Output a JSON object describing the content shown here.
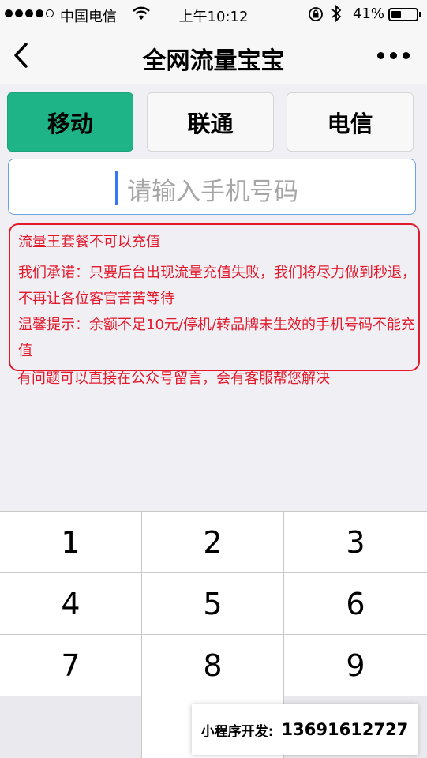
{
  "status_bar": {
    "carrier": "中国电信",
    "time": "上午10:12",
    "battery_percent": "41%",
    "battery_level": 0.41,
    "signal_bars_filled": 4,
    "signal_bars_total": 5
  },
  "nav": {
    "title": "全网流量宝宝"
  },
  "tabs": [
    {
      "label": "移动",
      "active": true
    },
    {
      "label": "联通",
      "active": false
    },
    {
      "label": "电信",
      "active": false
    }
  ],
  "phone_input": {
    "placeholder": "请输入手机号码",
    "value": ""
  },
  "notice": {
    "line1": "流量王套餐不可以充值",
    "line2": "我们承诺：只要后台出现流量充值失败，我们将尽力做到秒退，不再让各位客官苦苦等待",
    "line3": "温馨提示：余额不足10元/停机/转品牌未生效的手机号码不能充值",
    "help": "有问题可以直接在公众号留言，会有客服帮您解决"
  },
  "keypad": {
    "keys": [
      "1",
      "2",
      "3",
      "4",
      "5",
      "6",
      "7",
      "8",
      "9"
    ]
  },
  "banner": {
    "label": "小程序开发:",
    "phone": "13691612727"
  },
  "colors": {
    "accent_green": "#1fb487",
    "warning_red": "#e3192c",
    "input_border": "#6aa3e6",
    "caret": "#3478f6"
  },
  "icons": {
    "back": "chevron-left-icon",
    "more": "more-dots-icon",
    "wifi": "wifi-icon",
    "lock": "rotation-lock-icon",
    "bluetooth": "bluetooth-icon",
    "battery": "battery-icon"
  }
}
